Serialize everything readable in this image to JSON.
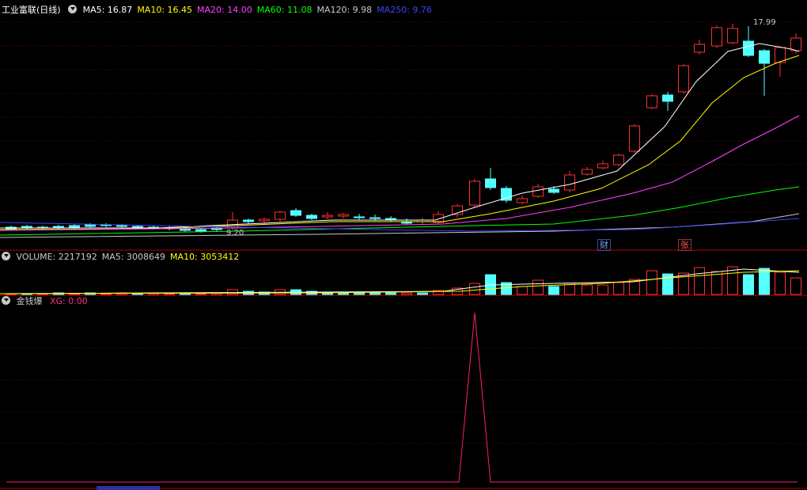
{
  "main": {
    "title": "工业富联(日线)",
    "ma": [
      {
        "label": "MA5: 16.87",
        "color": "#ffffff"
      },
      {
        "label": "MA10: 16.45",
        "color": "#ffff00"
      },
      {
        "label": "MA20: 14.00",
        "color": "#ff40ff"
      },
      {
        "label": "MA60: 11.08",
        "color": "#00ff00"
      },
      {
        "label": "MA120: 9.98",
        "color": "#c8c8c8"
      },
      {
        "label": "MA250: 9.76",
        "color": "#4040ff"
      }
    ],
    "high_label": "17.99",
    "low_label": "9.20",
    "tags": {
      "cai": "财",
      "zhang": "张"
    }
  },
  "volume": {
    "labels": [
      {
        "label": "VOLUME: 2217192",
        "color": "#c8c8c8"
      },
      {
        "label": "MA5: 3008649",
        "color": "#c8c8c8"
      },
      {
        "label": "MA10: 3053412",
        "color": "#ffff00"
      }
    ]
  },
  "indicator": {
    "title": "金钱爆",
    "labels": [
      {
        "label": "XG: 0.00",
        "color": "#ff3080"
      }
    ]
  },
  "colors": {
    "up": "#ff3030",
    "down": "#54ffff",
    "grid": "#7a0000",
    "xg": "#ff1a7a"
  }
}
